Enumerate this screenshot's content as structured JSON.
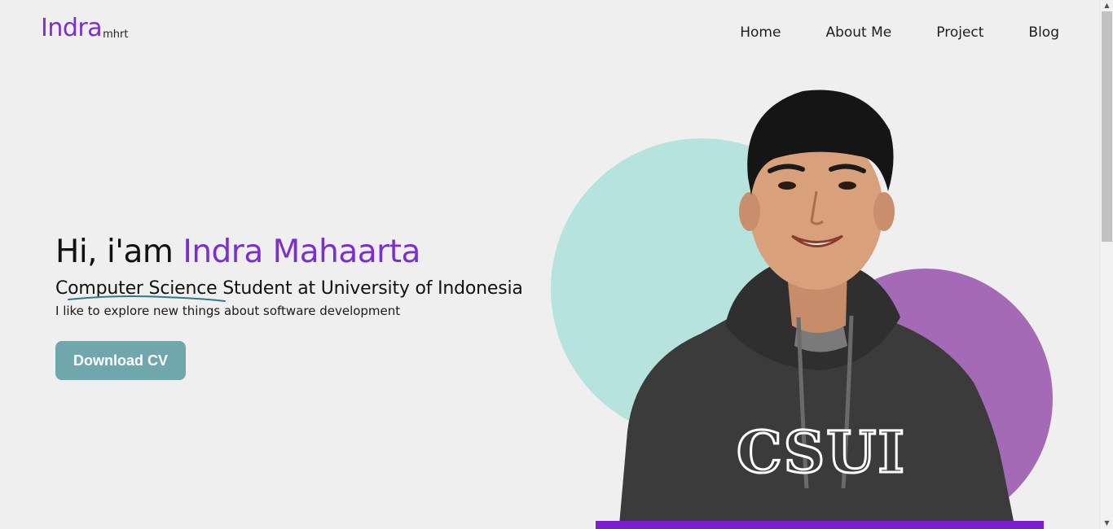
{
  "logo": {
    "main": "Indra",
    "sub": "mhrt"
  },
  "nav": [
    {
      "label": "Home"
    },
    {
      "label": "About Me"
    },
    {
      "label": "Project"
    },
    {
      "label": "Blog"
    }
  ],
  "hero": {
    "greeting": "Hi, i'am ",
    "name": "Indra Mahaarta",
    "subtitle": "Computer Science Student at University of Indonesia",
    "description": "I like to explore new things about software development",
    "cta_label": "Download CV"
  },
  "photo": {
    "shirt_text": "CSUI"
  },
  "colors": {
    "accent": "#7b2fd0",
    "button": "#6fa7ad",
    "teal_circle": "#b6e3dd",
    "purple_circle": "#a46ab6",
    "bottom_bar": "#7a1ed0"
  },
  "icons": {
    "scroll_up": "triangle-up-icon",
    "scroll_down": "triangle-down-icon"
  }
}
